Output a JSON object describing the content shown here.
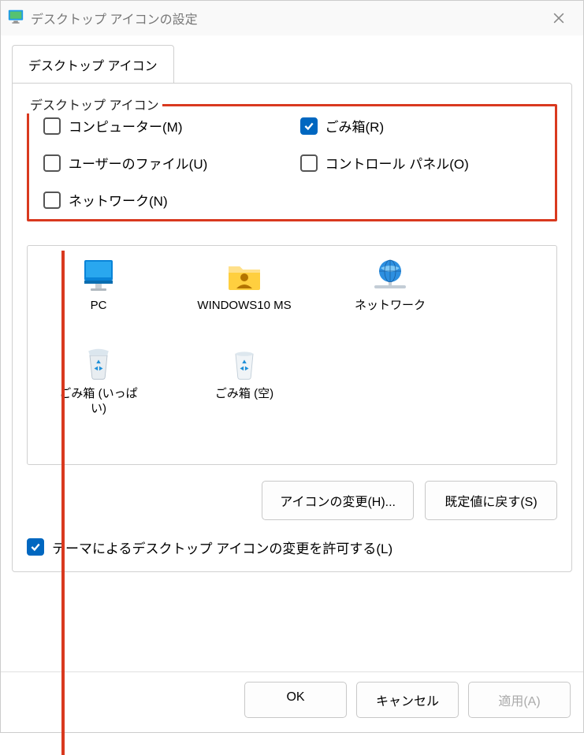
{
  "window": {
    "title": "デスクトップ アイコンの設定"
  },
  "tab": {
    "label": "デスクトップ アイコン"
  },
  "group": {
    "label": "デスクトップ アイコン"
  },
  "checkboxes": {
    "computer": {
      "label": "コンピューター(M)",
      "checked": false
    },
    "recycle": {
      "label": "ごみ箱(R)",
      "checked": true
    },
    "userfiles": {
      "label": "ユーザーのファイル(U)",
      "checked": false
    },
    "control": {
      "label": "コントロール パネル(O)",
      "checked": false
    },
    "network": {
      "label": "ネットワーク(N)",
      "checked": false
    }
  },
  "preview": {
    "pc": {
      "label": "PC"
    },
    "userfolder": {
      "label": "WINDOWS10 MS"
    },
    "network": {
      "label": "ネットワーク"
    },
    "bin_full": {
      "label": "ごみ箱 (いっぱい)"
    },
    "bin_empty": {
      "label": "ごみ箱 (空)"
    }
  },
  "buttons": {
    "change_icon": "アイコンの変更(H)...",
    "restore": "既定値に戻す(S)"
  },
  "allow_theme": {
    "label": "テーマによるデスクトップ アイコンの変更を許可する(L)",
    "checked": true
  },
  "dialog": {
    "ok": "OK",
    "cancel": "キャンセル",
    "apply": "適用(A)"
  }
}
